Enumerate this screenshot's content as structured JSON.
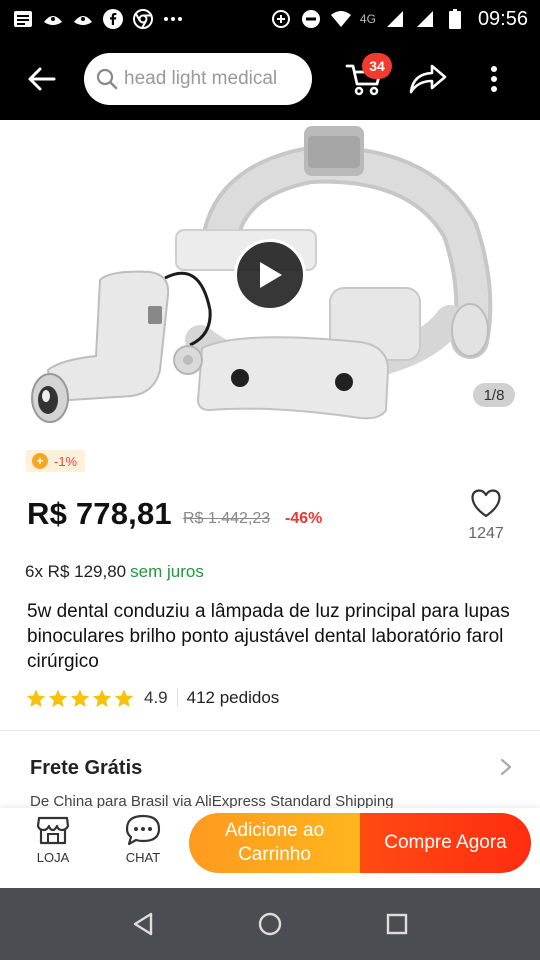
{
  "status_bar": {
    "time": "09:56",
    "network": "4G",
    "icons": [
      "message-icon",
      "notification-icon",
      "notification-icon",
      "facebook-icon",
      "chrome-icon",
      "overflow-dots-icon",
      "data-saver-icon",
      "dnd-icon",
      "wifi-icon",
      "signal-icon",
      "signal-icon",
      "battery-icon"
    ]
  },
  "header": {
    "search_placeholder": "head light medical",
    "cart_count": "34",
    "icons": {
      "back": "back-arrow-icon",
      "cart": "cart-icon",
      "share": "share-icon",
      "more": "more-vertical-icon"
    }
  },
  "gallery": {
    "counter": "1/8",
    "play_icon": "play-icon"
  },
  "product": {
    "coin_discount": "-1%",
    "price": "R$ 778,81",
    "old_price": "R$ 1.442,23",
    "discount": "-46%",
    "wishlist_count": "1247",
    "installment": "6x R$ 129,80",
    "installment_note": "sem juros",
    "title": "5w dental conduziu a lâmpada de luz principal para lupas binoculares brilho ponto ajustável dental laboratório farol cirúrgico",
    "rating": "4.9",
    "rating_stars": 5,
    "orders": "412 pedidos"
  },
  "shipping": {
    "title": "Frete Grátis",
    "subtitle": "De China para Brasil via AliExpress Standard Shipping"
  },
  "actions": {
    "store_label": "LOJA",
    "chat_label": "CHAT",
    "add_to_cart": "Adicione ao Carrinho",
    "buy_now": "Compre Agora"
  },
  "colors": {
    "accent_orange": "#ffa41c",
    "accent_red": "#ff3a12",
    "discount_red": "#e53935",
    "green": "#1d9a3c",
    "star": "#f7c20a"
  }
}
